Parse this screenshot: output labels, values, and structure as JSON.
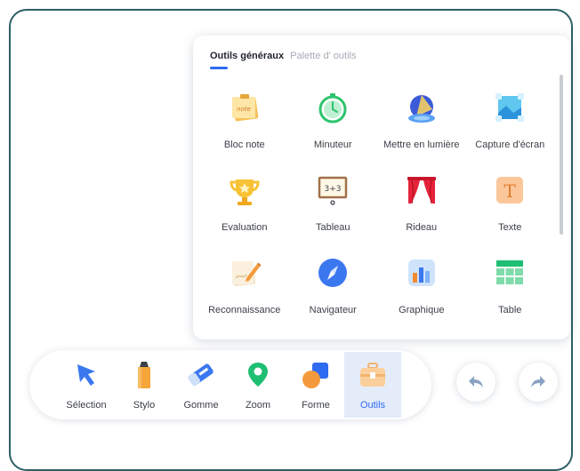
{
  "panel": {
    "tabs": [
      {
        "label": "Outils généraux"
      },
      {
        "label": "Palette d'  outils"
      }
    ],
    "tools": [
      {
        "label": "Bloc note",
        "icon": "sticky-note-icon"
      },
      {
        "label": "Minuteur",
        "icon": "stopwatch-icon"
      },
      {
        "label": "Mettre en lumière",
        "icon": "spotlight-icon"
      },
      {
        "label": "Capture d'écran",
        "icon": "screenshot-icon"
      },
      {
        "label": "Evaluation",
        "icon": "trophy-icon"
      },
      {
        "label": "Tableau",
        "icon": "blackboard-icon"
      },
      {
        "label": "Rideau",
        "icon": "curtain-icon"
      },
      {
        "label": "Texte",
        "icon": "text-icon"
      },
      {
        "label": "Reconnaissance",
        "icon": "recognition-icon"
      },
      {
        "label": "Navigateur",
        "icon": "compass-icon"
      },
      {
        "label": "Graphique",
        "icon": "bar-chart-icon"
      },
      {
        "label": "Table",
        "icon": "table-icon"
      }
    ],
    "note_icon_text": "note",
    "tableau_icon_text": "3+3",
    "texte_icon_text": "T"
  },
  "toolbar": {
    "items": [
      {
        "label": "Sélection",
        "icon": "cursor-arrow-icon"
      },
      {
        "label": "Stylo",
        "icon": "pen-icon"
      },
      {
        "label": "Gomme",
        "icon": "eraser-icon"
      },
      {
        "label": "Zoom",
        "icon": "zoom-pin-icon"
      },
      {
        "label": "Forme",
        "icon": "shapes-icon"
      },
      {
        "label": "Outils",
        "icon": "toolbox-icon"
      }
    ],
    "active": "Outils"
  },
  "colors": {
    "accent": "#2f6bf0",
    "frame": "#2d5f66",
    "active_bg": "#e4ecfa"
  }
}
